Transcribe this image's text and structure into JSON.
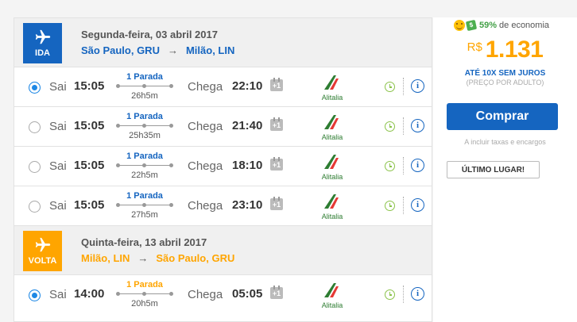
{
  "outbound": {
    "badge": "IDA",
    "date": "Segunda-feira, 03 abril 2017",
    "origin": "São Paulo, GRU",
    "destination": "Milão, LIN",
    "flights": [
      {
        "selected": true,
        "sai": "Sai",
        "dep": "15:05",
        "stops": "1 Parada",
        "duration": "26h5m",
        "chega": "Chega",
        "arr": "22:10",
        "plus": "+1",
        "airline": "Alitalia"
      },
      {
        "selected": false,
        "sai": "Sai",
        "dep": "15:05",
        "stops": "1 Parada",
        "duration": "25h35m",
        "chega": "Chega",
        "arr": "21:40",
        "plus": "+1",
        "airline": "Alitalia"
      },
      {
        "selected": false,
        "sai": "Sai",
        "dep": "15:05",
        "stops": "1 Parada",
        "duration": "22h5m",
        "chega": "Chega",
        "arr": "18:10",
        "plus": "+1",
        "airline": "Alitalia"
      },
      {
        "selected": false,
        "sai": "Sai",
        "dep": "15:05",
        "stops": "1 Parada",
        "duration": "27h5m",
        "chega": "Chega",
        "arr": "23:10",
        "plus": "+1",
        "airline": "Alitalia"
      }
    ]
  },
  "inbound": {
    "badge": "VOLTA",
    "date": "Quinta-feira, 13 abril 2017",
    "origin": "Milão, LIN",
    "destination": "São Paulo, GRU",
    "flights": [
      {
        "selected": true,
        "sai": "Sai",
        "dep": "14:00",
        "stops": "1 Parada",
        "duration": "20h5m",
        "chega": "Chega",
        "arr": "05:05",
        "plus": "+1",
        "airline": "Alitalia"
      }
    ]
  },
  "sidebar": {
    "savings_pct": "59%",
    "savings_text": "de economia",
    "currency": "R$",
    "price": "1.131",
    "installments": "ATÉ 10X SEM JUROS",
    "per_adult": "(PREÇO POR ADULTO)",
    "buy_label": "Comprar",
    "tax_note": "A incluir taxas e encargos",
    "last_seat": "ÚLTIMO LUGAR!"
  },
  "colors": {
    "blue": "#1565c0",
    "orange": "#ffa500",
    "green": "#43a047"
  },
  "icons": [
    "plane-icon",
    "arrow-right-icon",
    "calendar-plus-one-icon",
    "alitalia-logo",
    "clock-icon",
    "info-icon",
    "smiley-icon",
    "money-icon"
  ]
}
